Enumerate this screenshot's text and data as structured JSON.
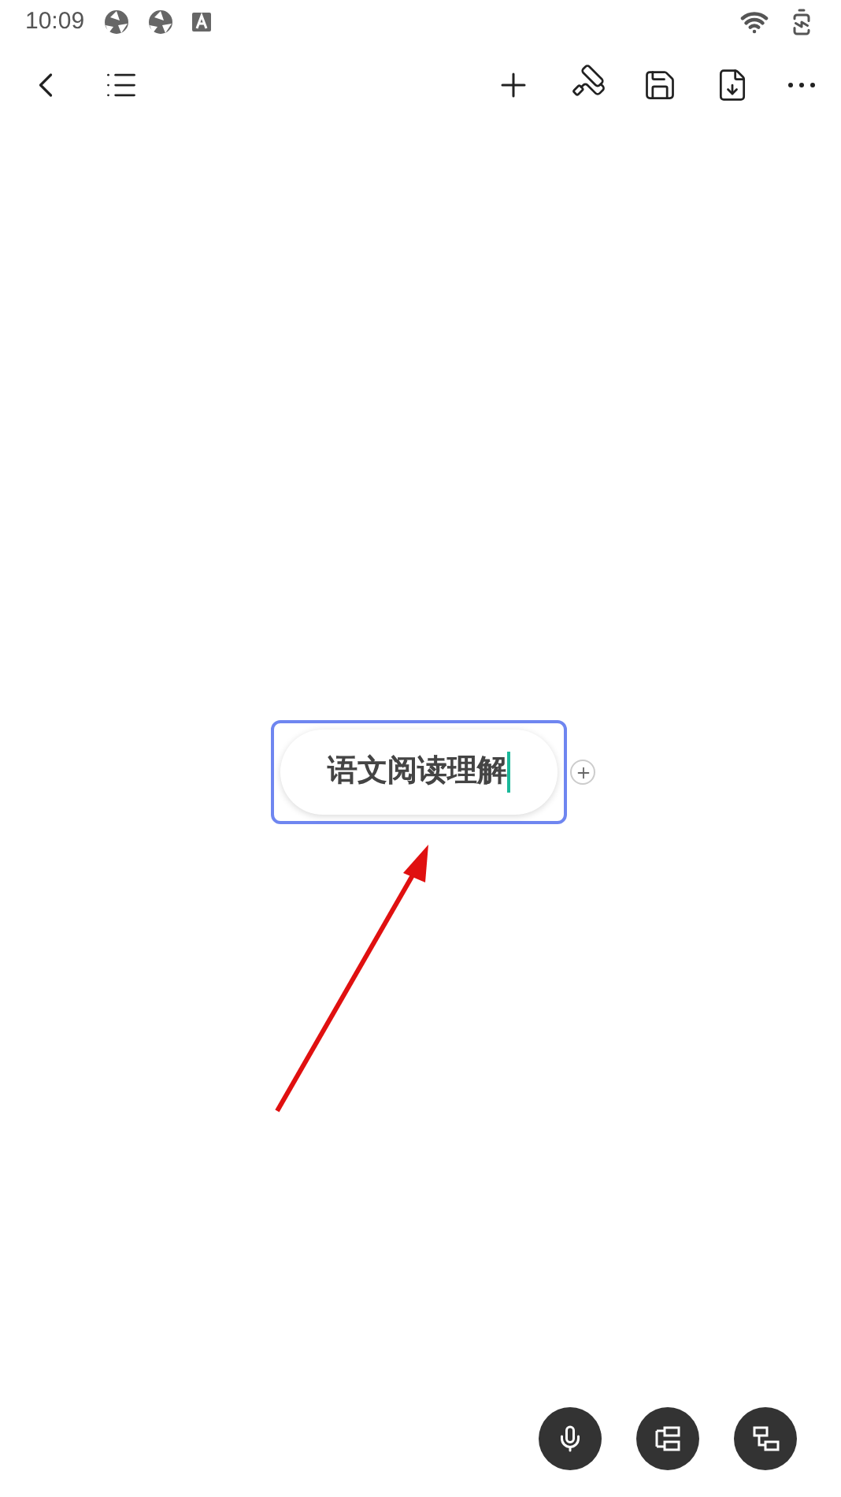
{
  "status_bar": {
    "time": "10:09"
  },
  "node": {
    "text": "语文阅读理解",
    "editing": true
  }
}
